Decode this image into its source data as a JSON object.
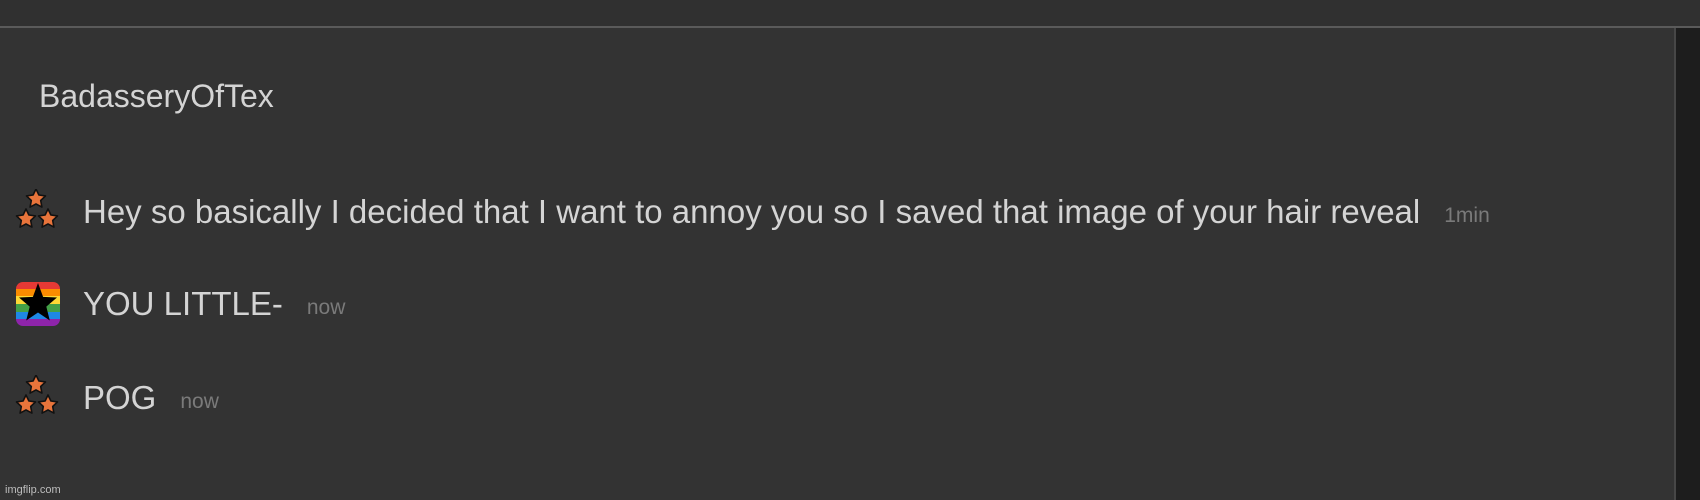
{
  "chat": {
    "title": "BadasseryOfTex"
  },
  "messages": [
    {
      "avatar_icon": "three-stars-icon",
      "text": "Hey so basically I decided that I want to annoy you so I saved that image of your hair reveal",
      "time": "1min"
    },
    {
      "avatar_icon": "rainbow-star-icon",
      "text": "YOU LITTLE-",
      "time": "now"
    },
    {
      "avatar_icon": "three-stars-icon",
      "text": "POG",
      "time": "now"
    }
  ],
  "watermark": "imgflip.com",
  "colors": {
    "background": "#333333",
    "text": "#d4d4d4",
    "timestamp": "#7a7a7a",
    "star_fill": "#e8743b"
  }
}
